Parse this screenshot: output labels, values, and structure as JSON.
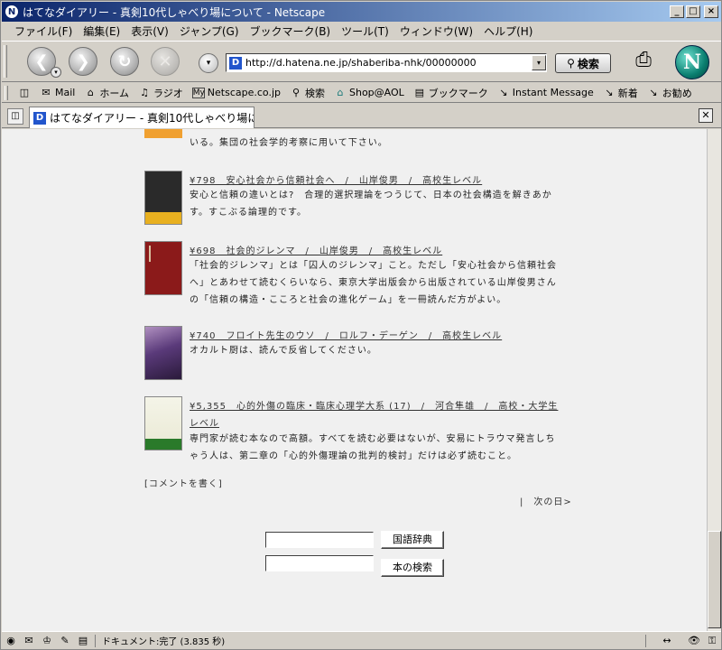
{
  "window": {
    "title": "はてなダイアリー - 真剣10代しゃべり場について - Netscape",
    "minimize": "_",
    "maximize": "□",
    "close": "×"
  },
  "menu": [
    "ファイル(F)",
    "編集(E)",
    "表示(V)",
    "ジャンプ(G)",
    "ブックマーク(B)",
    "ツール(T)",
    "ウィンドウ(W)",
    "ヘルプ(H)"
  ],
  "nav": {
    "url": "http://d.hatena.ne.jp/shaberiba-nhk/00000000",
    "search_label": "検索",
    "logo": "N"
  },
  "personal_toolbar": [
    {
      "icon": "mail-icon",
      "glyph": "✉",
      "label": "Mail"
    },
    {
      "icon": "home-icon",
      "glyph": "⌂",
      "label": "ホーム"
    },
    {
      "icon": "radio-icon",
      "glyph": "♫",
      "label": "ラジオ"
    },
    {
      "icon": "my-icon",
      "glyph": "My",
      "label": "Netscape.co.jp"
    },
    {
      "icon": "search-icon",
      "glyph": "⚲",
      "label": "検索"
    },
    {
      "icon": "aol-icon",
      "glyph": "⌂",
      "label": "Shop@AOL"
    },
    {
      "icon": "bookmark-icon",
      "glyph": "▤",
      "label": "ブックマーク"
    },
    {
      "icon": "link-icon",
      "glyph": "↘",
      "label": "Instant Message"
    },
    {
      "icon": "link-icon",
      "glyph": "↘",
      "label": "新着"
    },
    {
      "icon": "link-icon",
      "glyph": "↘",
      "label": "お勧め"
    }
  ],
  "tab": {
    "title": "はてなダイアリー - 真剣10代しゃべり場について"
  },
  "content": {
    "top_fragment": "いる。集団の社会学的考察に用いて下さい。",
    "books": [
      {
        "title": "¥798　安心社会から信頼社会へ　/　山岸俊男　/　高校生レベル",
        "desc": "安心と信頼の違いとは?　合理的選択理論をつうじて、日本の社会構造を解きあかす。すこぶる論理的です。",
        "cover_color": "#2a2a2a",
        "cover_accent": "#e8b020"
      },
      {
        "title": "¥698　社会的ジレンマ　/　山岸俊男　/　高校生レベル",
        "desc": "「社会的ジレンマ」とは「囚人のジレンマ」こと。ただし「安心社会から信頼社会へ」とあわせて読むくらいなら、東京大学出版会から出版されている山岸俊男さんの「信頼の構造・こころと社会の進化ゲーム」を一冊読んだ方がよい。",
        "cover_color": "#8b1a1a",
        "cover_accent": "#d8c0a0"
      },
      {
        "title": "¥740　フロイト先生のウソ　/　ロルフ・デーゲン　/　高校生レベル",
        "desc": "オカルト厨は、読んで反省してください。",
        "cover_color": "#5a3a7a",
        "cover_accent": "#b090c0"
      },
      {
        "title": "¥5,355　心的外傷の臨床・臨床心理学大系 (17)　/　河合隼雄　/　高校・大学生レベル",
        "desc": "専門家が読む本なので高額。すべてを読む必要はないが、安易にトラウマ発言しちゃう人は、第二章の「心的外傷理論の批判的検討」だけは必ず読むこと。",
        "cover_color": "#f4f4e8",
        "cover_accent": "#2a7a2a"
      }
    ],
    "comment_link": "[コメントを書く]",
    "next_day": "|　次の日>",
    "dict_button": "国語辞典",
    "book_search_button": "本の検索"
  },
  "status": {
    "text": "ドキュメント:完了 (3.835 秒)"
  }
}
